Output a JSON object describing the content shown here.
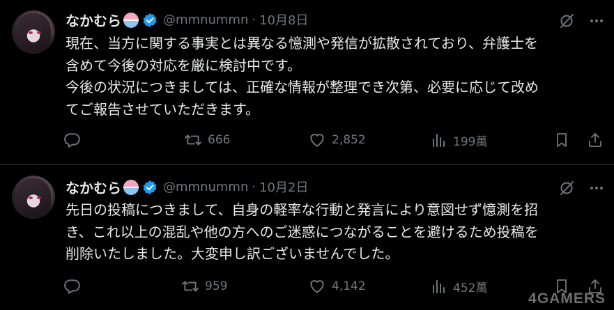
{
  "tweets": [
    {
      "author_name": "なかむら",
      "handle": "@mmnummn",
      "separator": "·",
      "date": "10月8日",
      "text_lines": [
        "現在、当方に関する事実とは異なる憶測や発信が拡散されており、弁護士を",
        "含めて今後の対応を厳に検討中です。",
        "今後の状況につきましては、正確な情報が整理でき次第、必要に応じて改め",
        "てご報告させていただきます。"
      ],
      "replies": "",
      "retweets": "666",
      "likes": "2,852",
      "views": "199萬"
    },
    {
      "author_name": "なかむら",
      "handle": "@mmnummn",
      "separator": "·",
      "date": "10月2日",
      "text_lines": [
        "先日の投稿につきまして、自身の軽率な行動と発言により意図せず憶測を招",
        "き、これ以上の混乱や他の方へのご迷惑につながることを避けるため投稿を",
        "削除いたしました。大変申し訳ございませんでした。"
      ],
      "replies": "",
      "retweets": "959",
      "likes": "4,142",
      "views": "452萬"
    }
  ],
  "watermark": "4GAMERS",
  "icons": [
    "avatar",
    "shaved-ice-emoji",
    "verified-badge-icon",
    "grok-icon",
    "more-icon",
    "reply-icon",
    "retweet-icon",
    "like-icon",
    "views-icon",
    "bookmark-icon",
    "share-icon"
  ],
  "colors": {
    "background": "#000000",
    "text": "#e7e9ea",
    "muted": "#71767b",
    "verified": "#1d9bf0",
    "divider": "#2f3336"
  }
}
